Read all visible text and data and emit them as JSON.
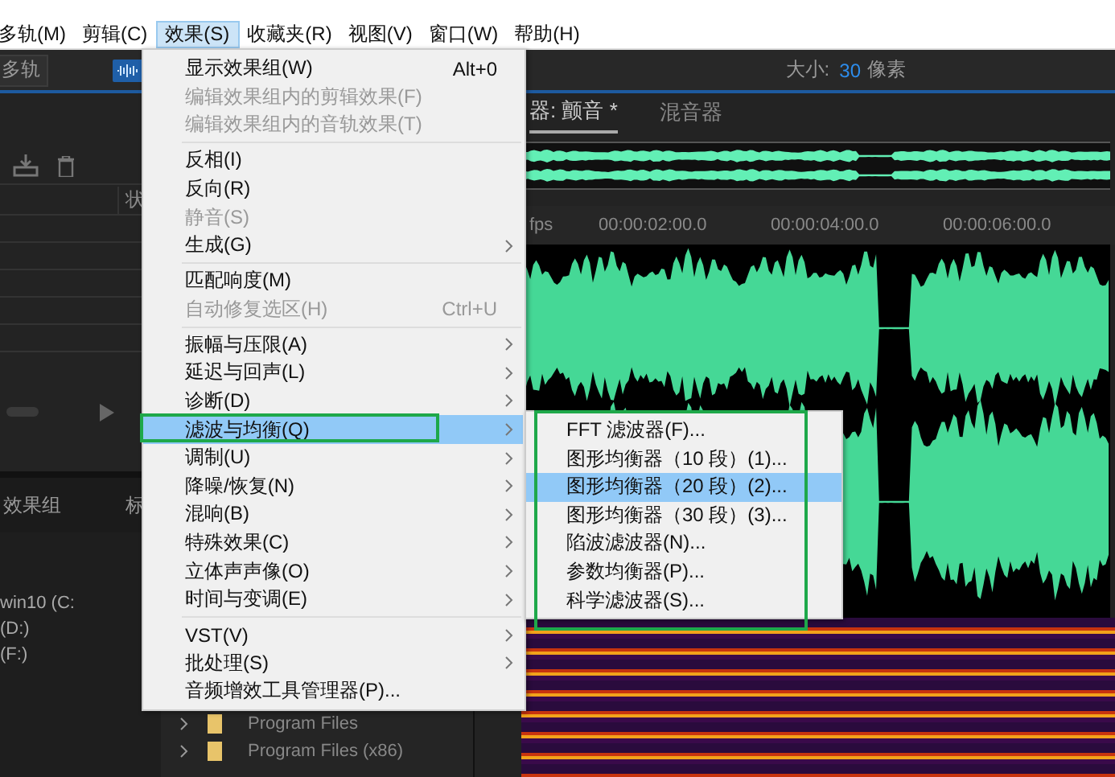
{
  "menu_bar": [
    {
      "label": "多轨(M)",
      "selected": false
    },
    {
      "label": "剪辑(C)",
      "selected": false
    },
    {
      "label": "效果(S)",
      "selected": true
    },
    {
      "label": "收藏夹(R)",
      "selected": false
    },
    {
      "label": "视图(V)",
      "selected": false
    },
    {
      "label": "窗口(W)",
      "selected": false
    },
    {
      "label": "帮助(H)",
      "selected": false
    }
  ],
  "toolbar": {
    "mode_button": "多轨",
    "size_label": "大小:",
    "size_value": "30",
    "size_unit": "像素"
  },
  "files_panel": {
    "column_header": "状"
  },
  "lower_panel": {
    "tabs": [
      "效果组",
      "标"
    ],
    "drives": [
      "win10 (C:",
      "(D:)",
      "(F:)"
    ],
    "folders": [
      "Program Files",
      "Program Files (x86)"
    ]
  },
  "editor": {
    "tabs": [
      {
        "label": "器: 颤音 *",
        "selected": true
      },
      {
        "label": "混音器",
        "selected": false
      }
    ],
    "ruler": [
      "fps",
      "00:00:02:00.0",
      "00:00:04:00.0",
      "00:00:06:00.0"
    ]
  },
  "effects_menu": [
    {
      "kind": "item",
      "label": "显示效果组(W)",
      "shortcut": "Alt+0",
      "disabled": false,
      "submenu": false,
      "selected": false
    },
    {
      "kind": "item",
      "label": "编辑效果组内的剪辑效果(F)",
      "disabled": true,
      "submenu": false,
      "selected": false
    },
    {
      "kind": "item",
      "label": "编辑效果组内的音轨效果(T)",
      "disabled": true,
      "submenu": false,
      "selected": false
    },
    {
      "kind": "separator"
    },
    {
      "kind": "item",
      "label": "反相(I)",
      "disabled": false,
      "submenu": false,
      "selected": false
    },
    {
      "kind": "item",
      "label": "反向(R)",
      "disabled": false,
      "submenu": false,
      "selected": false
    },
    {
      "kind": "item",
      "label": "静音(S)",
      "disabled": true,
      "submenu": false,
      "selected": false
    },
    {
      "kind": "item",
      "label": "生成(G)",
      "disabled": false,
      "submenu": true,
      "selected": false
    },
    {
      "kind": "separator"
    },
    {
      "kind": "item",
      "label": "匹配响度(M)",
      "disabled": false,
      "submenu": false,
      "selected": false
    },
    {
      "kind": "item",
      "label": "自动修复选区(H)",
      "shortcut": "Ctrl+U",
      "disabled": true,
      "submenu": false,
      "selected": false
    },
    {
      "kind": "separator"
    },
    {
      "kind": "item",
      "label": "振幅与压限(A)",
      "disabled": false,
      "submenu": true,
      "selected": false
    },
    {
      "kind": "item",
      "label": "延迟与回声(L)",
      "disabled": false,
      "submenu": true,
      "selected": false
    },
    {
      "kind": "item",
      "label": "诊断(D)",
      "disabled": false,
      "submenu": true,
      "selected": false
    },
    {
      "kind": "item",
      "label": "滤波与均衡(Q)",
      "disabled": false,
      "submenu": true,
      "selected": true
    },
    {
      "kind": "item",
      "label": "调制(U)",
      "disabled": false,
      "submenu": true,
      "selected": false
    },
    {
      "kind": "item",
      "label": "降噪/恢复(N)",
      "disabled": false,
      "submenu": true,
      "selected": false
    },
    {
      "kind": "item",
      "label": "混响(B)",
      "disabled": false,
      "submenu": true,
      "selected": false
    },
    {
      "kind": "item",
      "label": "特殊效果(C)",
      "disabled": false,
      "submenu": true,
      "selected": false
    },
    {
      "kind": "item",
      "label": "立体声声像(O)",
      "disabled": false,
      "submenu": true,
      "selected": false
    },
    {
      "kind": "item",
      "label": "时间与变调(E)",
      "disabled": false,
      "submenu": true,
      "selected": false
    },
    {
      "kind": "separator"
    },
    {
      "kind": "item",
      "label": "VST(V)",
      "disabled": false,
      "submenu": true,
      "selected": false
    },
    {
      "kind": "item",
      "label": "批处理(S)",
      "disabled": false,
      "submenu": true,
      "selected": false
    },
    {
      "kind": "item",
      "label": "音频增效工具管理器(P)...",
      "disabled": false,
      "submenu": false,
      "selected": false
    }
  ],
  "filter_submenu": [
    {
      "label": "FFT 滤波器(F)...",
      "selected": false
    },
    {
      "label": "图形均衡器（10 段）(1)...",
      "selected": false
    },
    {
      "label": "图形均衡器（20 段）(2)...",
      "selected": true
    },
    {
      "label": "图形均衡器（30 段）(3)...",
      "selected": false
    },
    {
      "label": "陷波滤波器(N)...",
      "selected": false
    },
    {
      "label": "参数均衡器(P)...",
      "selected": false
    },
    {
      "label": "科学滤波器(S)...",
      "selected": false
    }
  ]
}
